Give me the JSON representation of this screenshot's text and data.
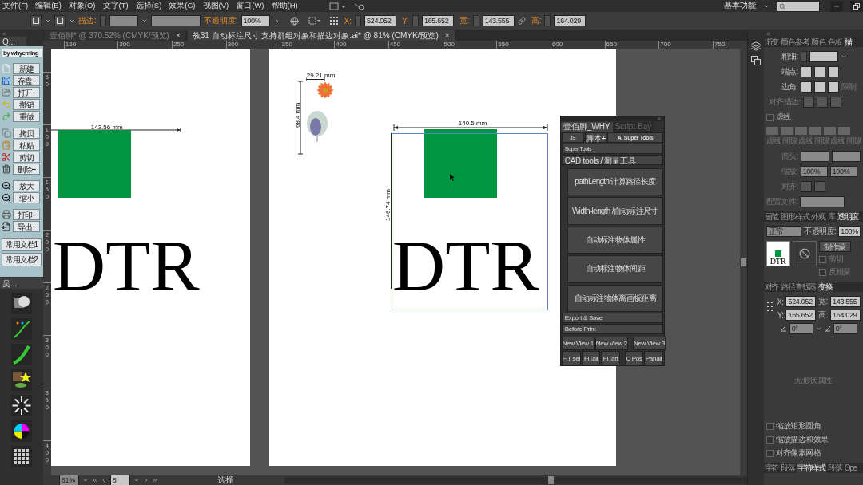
{
  "menu_bar": {
    "items": [
      "文件(F)",
      "编辑(E)",
      "对象(O)",
      "文字(T)",
      "选择(S)",
      "效果(C)",
      "视图(V)",
      "窗口(W)",
      "帮助(H)"
    ],
    "workspace": "基本功能"
  },
  "control_bar": {
    "stroke_label": "描边:",
    "opacity_label": "不透明度:",
    "opacity": "100%",
    "fields": [
      {
        "label": "X:",
        "value": "524.052"
      },
      {
        "label": "Y:",
        "value": "165.652"
      },
      {
        "label": "宽:",
        "value": "143.555"
      },
      {
        "label": "高:",
        "value": "164.029"
      }
    ]
  },
  "document_tabs": [
    {
      "label": "壹佰脚* @ 370.52% (CMYK/预览)",
      "selected": false,
      "close": "×"
    },
    {
      "label": "教31 自动标注尺寸 支持群组对象和描边对象.ai* @ 81% (CMYK/预览)",
      "selected": true,
      "close": "×"
    }
  ],
  "ruler": {
    "horizontal": [
      "150",
      "200",
      "250",
      "300",
      "350",
      "400",
      "450",
      "500",
      "550",
      "600",
      "650",
      "700",
      "750"
    ],
    "vertical": [
      "50",
      "100",
      "150",
      "200",
      "250",
      "300",
      "350",
      "400"
    ]
  },
  "left_panel": {
    "title": "Q...",
    "author": "by whyeming",
    "groups": [
      [
        "新建",
        "存盘+",
        "打开+",
        "撤销",
        "重做"
      ],
      [
        "拷贝",
        "粘贴",
        "剪切",
        "删除+"
      ],
      [
        "放大",
        "缩小"
      ],
      [
        "打印+",
        "导出+"
      ]
    ],
    "documents": [
      "常用文档1",
      "常用文档2"
    ],
    "tools_title": "吴..."
  },
  "left_artboard": {
    "width_label": "143.56 mm",
    "text": "DTR"
  },
  "right_artboard": {
    "small_width": "29.21 mm",
    "small_height": "68.4 mm",
    "width_label": "140.5 mm",
    "height_label": "146.74 mm",
    "text": "DTR"
  },
  "script_panel": {
    "tabs": [
      {
        "label": "壹佰脚_WHY",
        "selected": true
      },
      {
        "label": "Script Bay",
        "selected": false
      }
    ],
    "top_buttons": [
      "JS",
      "脚本+",
      "AI Super Tools"
    ],
    "sections": [
      "Super Tools",
      "CAD tools / 测量工具"
    ],
    "tools": [
      "pathLength 计算路径长度",
      "Width-length /自动标注尺寸",
      "自动标注物体属性",
      "自动标注物体间距",
      "自动标注物体离画板距离"
    ],
    "footer_sections": [
      "Export & Save",
      "Before Print"
    ],
    "view_buttons": [
      "New View 1",
      "New View 2",
      "New View 3"
    ],
    "fit_buttons": [
      "FIT sel",
      "FITall",
      "FITart",
      "C Pos",
      "Panall"
    ]
  },
  "stroke_panel": {
    "tabs": [
      {
        "label": "渐变",
        "selected": false
      },
      {
        "label": "颜色参考",
        "selected": false
      },
      {
        "label": "颜色",
        "selected": false
      },
      {
        "label": "色板",
        "selected": false
      },
      {
        "label": "描",
        "selected": true
      }
    ],
    "weight_label": "粗细:",
    "cap_label": "端点:",
    "corner_label": "边角:",
    "limit_label": "限制:",
    "align_label": "对齐描边:",
    "dashed": {
      "label": "虚线",
      "checked": false
    },
    "dash_labels": [
      "虚线",
      "间隙",
      "虚线",
      "间隙",
      "虚线",
      "间隙"
    ],
    "arrow_label": "箭头:",
    "scale_label": "缩放:",
    "scales": [
      "100%",
      "100%"
    ],
    "arrow_align_label": "对齐:",
    "profile_label": "配置文件:"
  },
  "transparency_panel": {
    "tabs": [
      {
        "label": "画笔",
        "selected": false
      },
      {
        "label": "图形样式",
        "selected": false
      },
      {
        "label": "外观",
        "selected": false
      },
      {
        "label": "库",
        "selected": false
      },
      {
        "label": "透明度",
        "selected": true
      }
    ],
    "blend_mode": "正常",
    "opacity_label": "不透明度:",
    "opacity": "100%",
    "thumbnail_text": "DTR",
    "make_mask": "制作蒙",
    "options": [
      {
        "label": "剪切",
        "checked": false
      },
      {
        "label": "反相蒙",
        "checked": false
      }
    ]
  },
  "transform_panel": {
    "tabs": [
      {
        "label": "对齐",
        "selected": false
      },
      {
        "label": "路径查找器",
        "selected": false
      },
      {
        "label": "变换",
        "selected": true
      }
    ],
    "fields": [
      {
        "label": "X:",
        "value": "524.052"
      },
      {
        "label": "宽:",
        "value": "143.555"
      },
      {
        "label": "Y:",
        "value": "165.652"
      },
      {
        "label": "高:",
        "value": "164.029"
      }
    ],
    "rotate": "0°",
    "shear": "0°",
    "empty_note": "无形状属性",
    "options": [
      {
        "label": "缩放矩形圆角",
        "checked": false
      },
      {
        "label": "缩放描边和效果",
        "checked": false
      },
      {
        "label": "对齐像素网格",
        "checked": false
      }
    ]
  },
  "character_panel": {
    "tabs": [
      {
        "label": "字符",
        "selected": false
      },
      {
        "label": "段落",
        "selected": false
      },
      {
        "label": "字符样式",
        "selected": true
      },
      {
        "label": "段落",
        "selected": false
      },
      {
        "label": "Ope",
        "selected": false
      }
    ]
  },
  "status_bar": {
    "zoom": "81%",
    "page": "8",
    "tool": "选择"
  }
}
